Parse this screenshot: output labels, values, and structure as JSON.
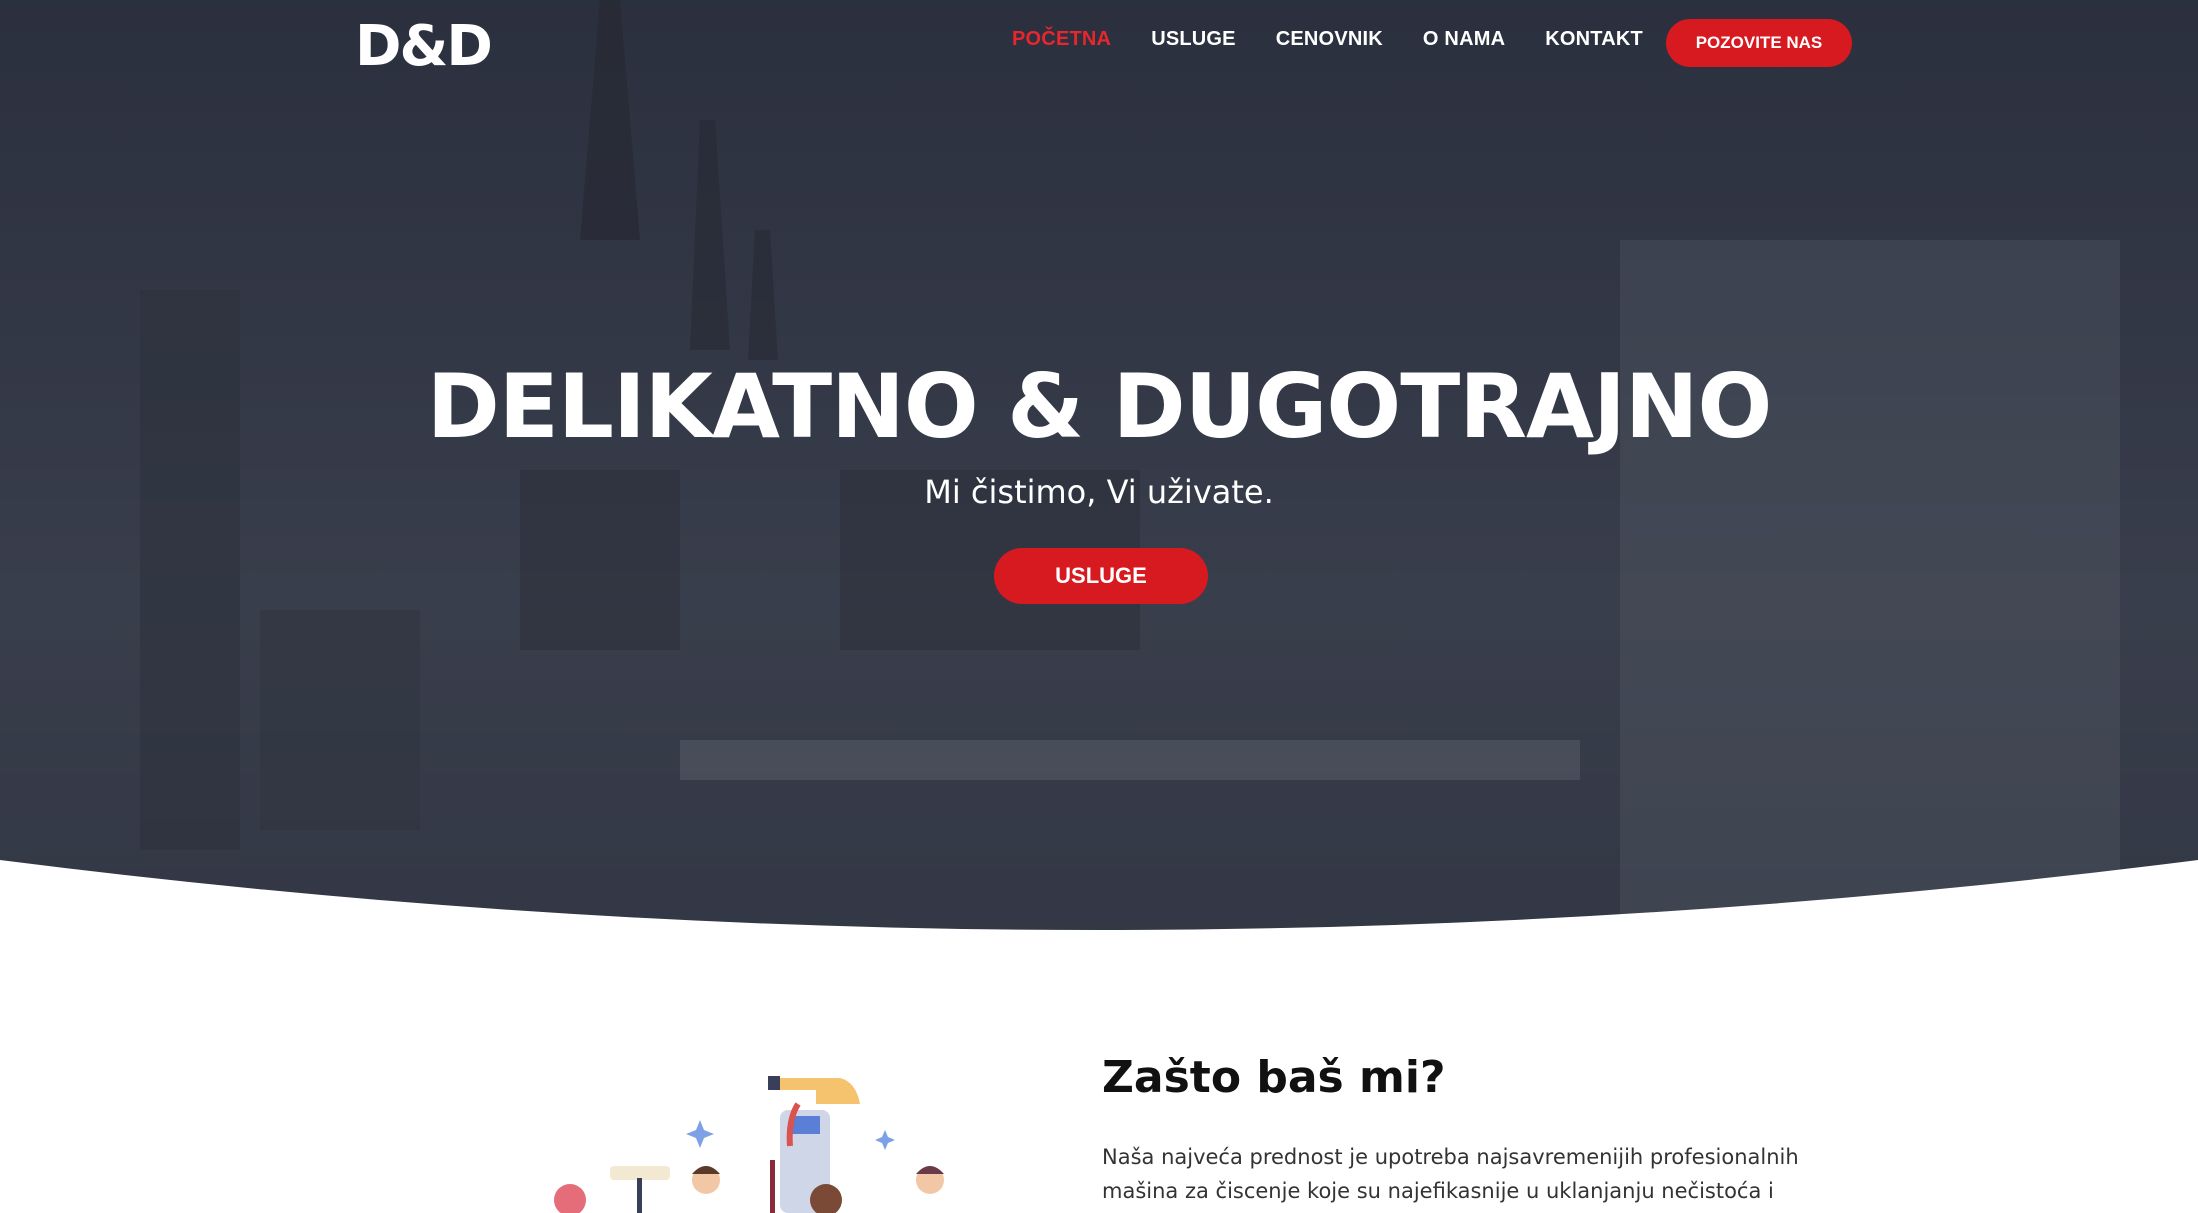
{
  "brand": {
    "logo_text": "D&D"
  },
  "nav": {
    "items": [
      {
        "label": "POČETNA",
        "active": true
      },
      {
        "label": "USLUGE",
        "active": false
      },
      {
        "label": "CENOVNIK",
        "active": false
      },
      {
        "label": "O NAMA",
        "active": false
      },
      {
        "label": "KONTAKT",
        "active": false
      }
    ],
    "call_button": "POZOVITE NAS"
  },
  "hero": {
    "title": "DELIKATNO & DUGOTRAJNO",
    "subtitle": "Mi čistimo, Vi uživate.",
    "button": "USLUGE"
  },
  "why": {
    "title": "Zašto baš mi?",
    "text": "Naša najveća prednost je upotreba najsavremenijih profesionalnih mašina za čiscenje koje su najefikasnije u uklanjanju nečistoća i"
  },
  "colors": {
    "accent": "#d71920",
    "active_nav": "#e8262d",
    "hero_overlay": "#2a2f3c"
  },
  "icons": [
    "cleaning-illustration"
  ]
}
